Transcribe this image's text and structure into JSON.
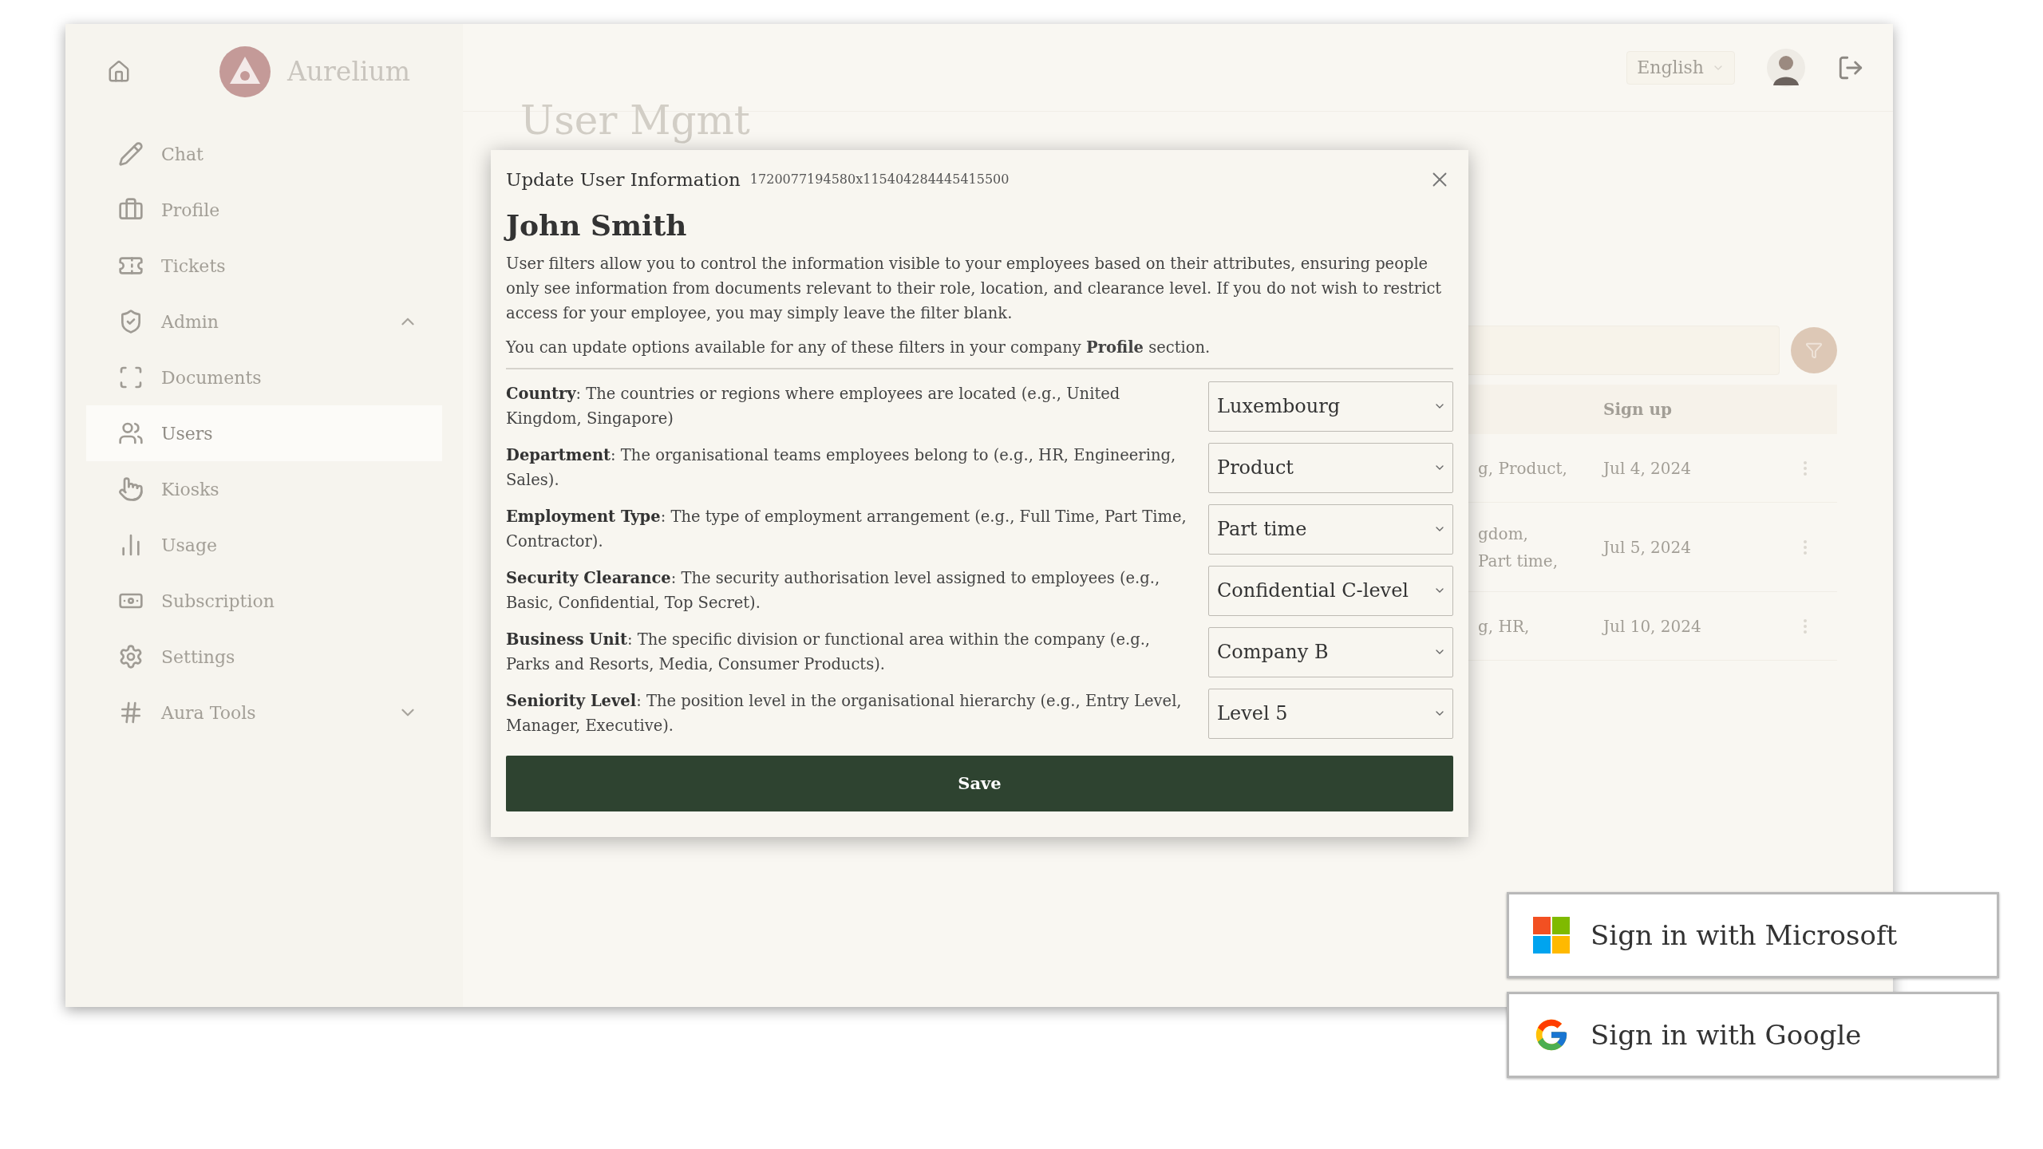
{
  "app": {
    "brand": "Aurelium"
  },
  "sidebar": {
    "items": [
      {
        "label": "Chat",
        "kind": "link",
        "selected": false
      },
      {
        "label": "Profile",
        "kind": "link",
        "selected": false
      },
      {
        "label": "Tickets",
        "kind": "link",
        "selected": false
      },
      {
        "label": "Admin",
        "kind": "group",
        "selected": false,
        "expanded": true
      },
      {
        "label": "Documents",
        "kind": "link",
        "selected": false
      },
      {
        "label": "Users",
        "kind": "link",
        "selected": true
      },
      {
        "label": "Kiosks",
        "kind": "link",
        "selected": false
      },
      {
        "label": "Usage",
        "kind": "link",
        "selected": false
      },
      {
        "label": "Subscription",
        "kind": "link",
        "selected": false
      },
      {
        "label": "Settings",
        "kind": "link",
        "selected": false
      },
      {
        "label": "Aura Tools",
        "kind": "group",
        "selected": false,
        "expanded": false
      }
    ]
  },
  "header": {
    "language": "English"
  },
  "main": {
    "title": "User Mgmt",
    "table": {
      "columns": [
        "Sign up"
      ],
      "rows": [
        {
          "column_1": [
            "g, Product,"
          ],
          "sign_up": "Jul 4, 2024"
        },
        {
          "column_1": [
            "gdom,",
            "Part time,"
          ],
          "sign_up": "Jul 5, 2024"
        },
        {
          "column_1": [
            "g, HR,"
          ],
          "sign_up": "Jul 10, 2024"
        }
      ]
    }
  },
  "dialog": {
    "title": "Update User Information",
    "id": "1720077194580x115404284445415500",
    "name": "John Smith",
    "paragraphs": [
      "User filters allow you to control the information visible to your employees based on their attributes, ensuring people only see information from documents relevant to their role, location, and clearance level. If you do not wish to restrict access for your employee, you may simply leave the filter blank.",
      "You can update options available for any of these filters in your company **Profile** section."
    ],
    "fields": [
      {
        "label": "Country",
        "description": ": The countries or regions where employees are located (e.g., United Kingdom, Singapore)",
        "value": "Luxembourg"
      },
      {
        "label": "Department",
        "description": ": The organisational teams employees belong to (e.g., HR, Engineering, Sales).",
        "value": "Product"
      },
      {
        "label": "Employment Type",
        "description": ": The type of employment arrangement (e.g., Full Time, Part Time, Contractor).",
        "value": "Part time"
      },
      {
        "label": "Security Clearance",
        "description": ": The security authorisation level assigned to employees (e.g., Basic, Confidential, Top Secret).",
        "value": "Confidential C-level"
      },
      {
        "label": "Business Unit",
        "description": ": The specific division or functional area within the company (e.g., Parks and Resorts, Media, Consumer Products).",
        "value": "Company B"
      },
      {
        "label": "Seniority Level",
        "description": ": The position level in the organisational hierarchy (e.g., Entry Level, Manager, Executive).",
        "value": "Level 5"
      }
    ],
    "save": "Save"
  },
  "sign_in": [
    {
      "kind": "microsoft",
      "label": "Sign in with Microsoft"
    },
    {
      "kind": "google",
      "label": "Sign in with Google"
    }
  ]
}
